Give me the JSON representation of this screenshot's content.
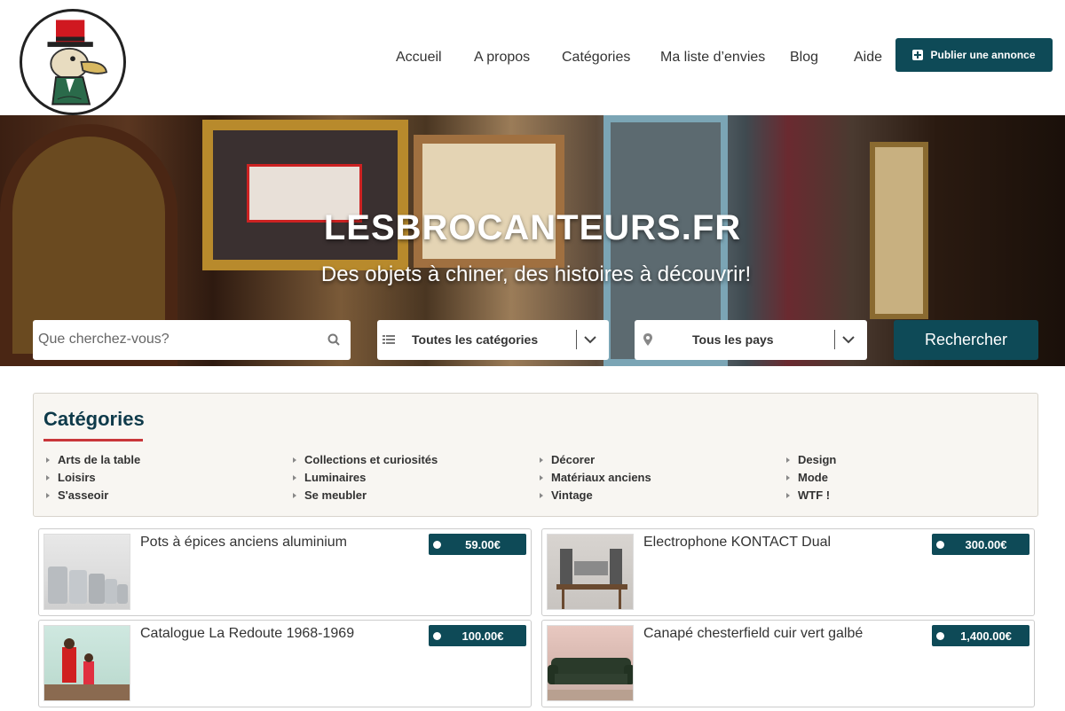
{
  "header": {
    "nav": [
      {
        "label": "Accueil"
      },
      {
        "label": "A propos"
      },
      {
        "label": "Catégories"
      },
      {
        "label": "Ma liste d’envies"
      },
      {
        "label": "Blog"
      },
      {
        "label": "Aide"
      }
    ],
    "publish_label": "Publier une annonce"
  },
  "hero": {
    "title": "LESBROCANTEURS.FR",
    "subtitle": "Des objets à chiner, des histoires à découvrir!",
    "search_placeholder": "Que cherchez-vous?",
    "category_select": "Toutes les catégories",
    "country_select": "Tous les pays",
    "search_button": "Rechercher"
  },
  "categories": {
    "title": "Catégories",
    "items": [
      "Arts de la table",
      "Collections et curiosités",
      "Décorer",
      "Design",
      "Loisirs",
      "Luminaires",
      "Matériaux anciens",
      "Mode",
      "S'asseoir",
      "Se meubler",
      "Vintage",
      "WTF !"
    ]
  },
  "listings": [
    {
      "title": "Pots à épices anciens aluminium",
      "price": "59.00€"
    },
    {
      "title": "Electrophone KONTACT Dual",
      "price": "300.00€"
    },
    {
      "title": "Catalogue La Redoute 1968-1969",
      "price": "100.00€"
    },
    {
      "title": "Canapé chesterfield cuir vert galbé",
      "price": "1,400.00€"
    }
  ],
  "colors": {
    "primary": "#0e4a57",
    "accent_red": "#c9363a",
    "heading": "#0e3a4a"
  }
}
